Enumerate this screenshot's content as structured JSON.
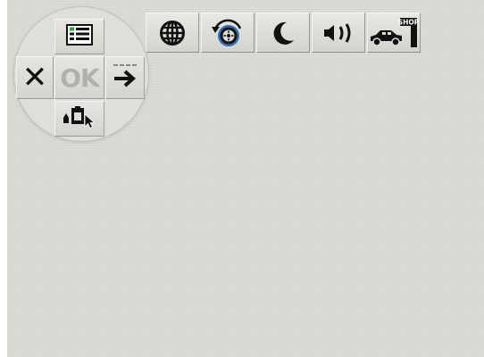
{
  "pad": {
    "top_icon": "menu-list-icon",
    "cancel_label": "✕",
    "cancel_icon": "close-icon",
    "ok_label": "OK",
    "right_icon": "next-arrow-icon",
    "bottom_icon": "touch-select-icon"
  },
  "toolbar": {
    "items": [
      {
        "icon": "globe-icon"
      },
      {
        "icon": "wheel-rotation-icon"
      },
      {
        "icon": "moon-icon"
      },
      {
        "icon": "speaker-icon"
      },
      {
        "icon": "car-shop-icon",
        "text": "SHOP"
      }
    ]
  },
  "colors": {
    "background": "#dcdbd6",
    "button_face": "#dddcd6",
    "icon_dark": "#111111",
    "ok_disabled": "#b1b1ac",
    "accent_blue": "#2f6fb4",
    "accent_green": "#3a9a3a"
  }
}
